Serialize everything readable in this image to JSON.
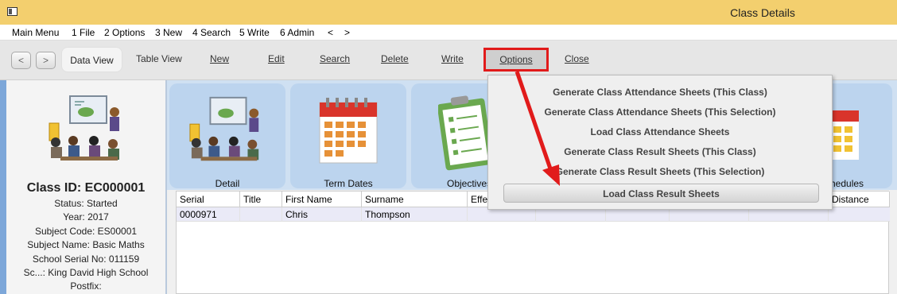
{
  "window": {
    "title": "Class Details"
  },
  "menu": [
    "Main Menu",
    "1 File",
    "2 Options",
    "3 New",
    "4 Search",
    "5 Write",
    "6 Admin",
    "<",
    ">"
  ],
  "toolbar": {
    "back": "<",
    "forward": ">",
    "data_view": "Data View",
    "table_view": "Table View",
    "new": "New",
    "edit": "Edit",
    "search": "Search",
    "delete": "Delete",
    "write": "Write",
    "options": "Options",
    "close": "Close"
  },
  "class": {
    "id": "Class ID: EC000001",
    "status": "Status: Started",
    "year": "Year: 2017",
    "subject_code": "Subject Code: ES00001",
    "subject_name": "Subject Name: Basic Maths",
    "school_serial": "School Serial No: 011159",
    "school": "Sc...: King David High School",
    "postfix": "Postfix:"
  },
  "tiles": [
    "Detail",
    "Term Dates",
    "Objectives",
    "Schedules"
  ],
  "grid": {
    "columns": [
      "Serial",
      "Title",
      "First Name",
      "Surname",
      "Effe",
      "Distance"
    ],
    "rows": [
      {
        "serial": "0000971",
        "title": "",
        "first_name": "Chris",
        "surname": "Thompson"
      }
    ]
  },
  "options_menu": [
    "Generate Class Attendance Sheets (This Class)",
    "Generate Class Attendance Sheets (This Selection)",
    "Load Class Attendance Sheets",
    "Generate Class Result Sheets (This Class)",
    "Generate Class Result Sheets (This Selection)",
    "Load Class Result Sheets"
  ],
  "colors": {
    "titlebar": "#f3cf6e",
    "highlight": "#e11b1b",
    "tile": "#bcd4ee",
    "panel_border": "#7da7d9"
  }
}
